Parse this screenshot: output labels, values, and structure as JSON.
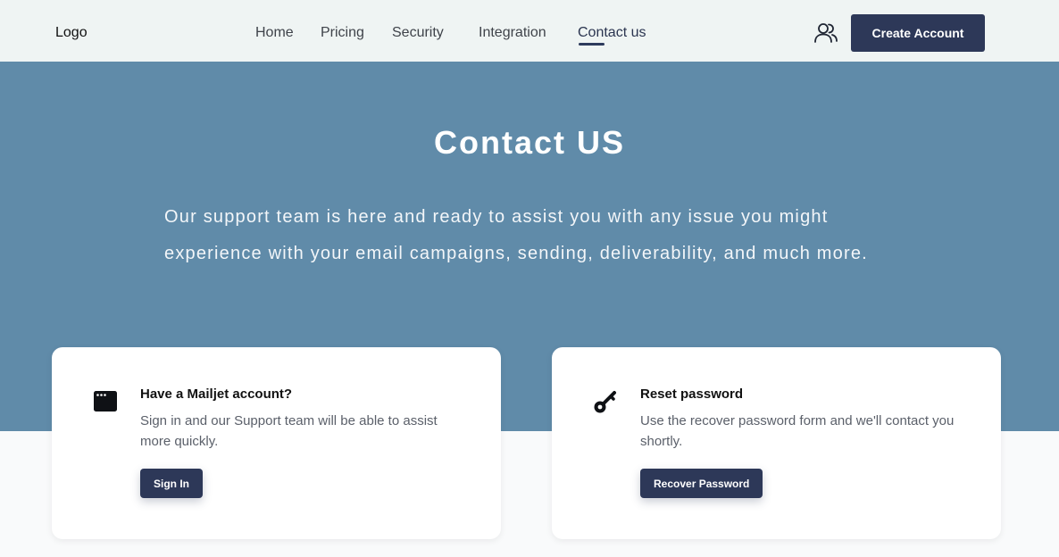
{
  "header": {
    "logo": "Logo",
    "nav": [
      {
        "label": "Home"
      },
      {
        "label": "Pricing"
      },
      {
        "label": "Security"
      },
      {
        "label": "Integration"
      },
      {
        "label": "Contact us",
        "active": true
      }
    ],
    "create_account_label": "Create Account"
  },
  "hero": {
    "title": "Contact US",
    "description_line1": "Our support team is here and ready to assist you with any issue you might",
    "description_line2": "experience with your email campaigns, sending, deliverability, and much more."
  },
  "cards": [
    {
      "icon": "browser-window-icon",
      "title": "Have a Mailjet account?",
      "description": "Sign in and our Support team will be able to assist more quickly.",
      "button": "Sign In"
    },
    {
      "icon": "key-icon",
      "title": "Reset password",
      "description": "Use the recover password form and we'll contact you shortly.",
      "button": "Recover Password"
    }
  ],
  "colors": {
    "hero_bg": "#608ba9",
    "primary_button": "#2d3858",
    "navbar_bg": "#eff4f3"
  }
}
